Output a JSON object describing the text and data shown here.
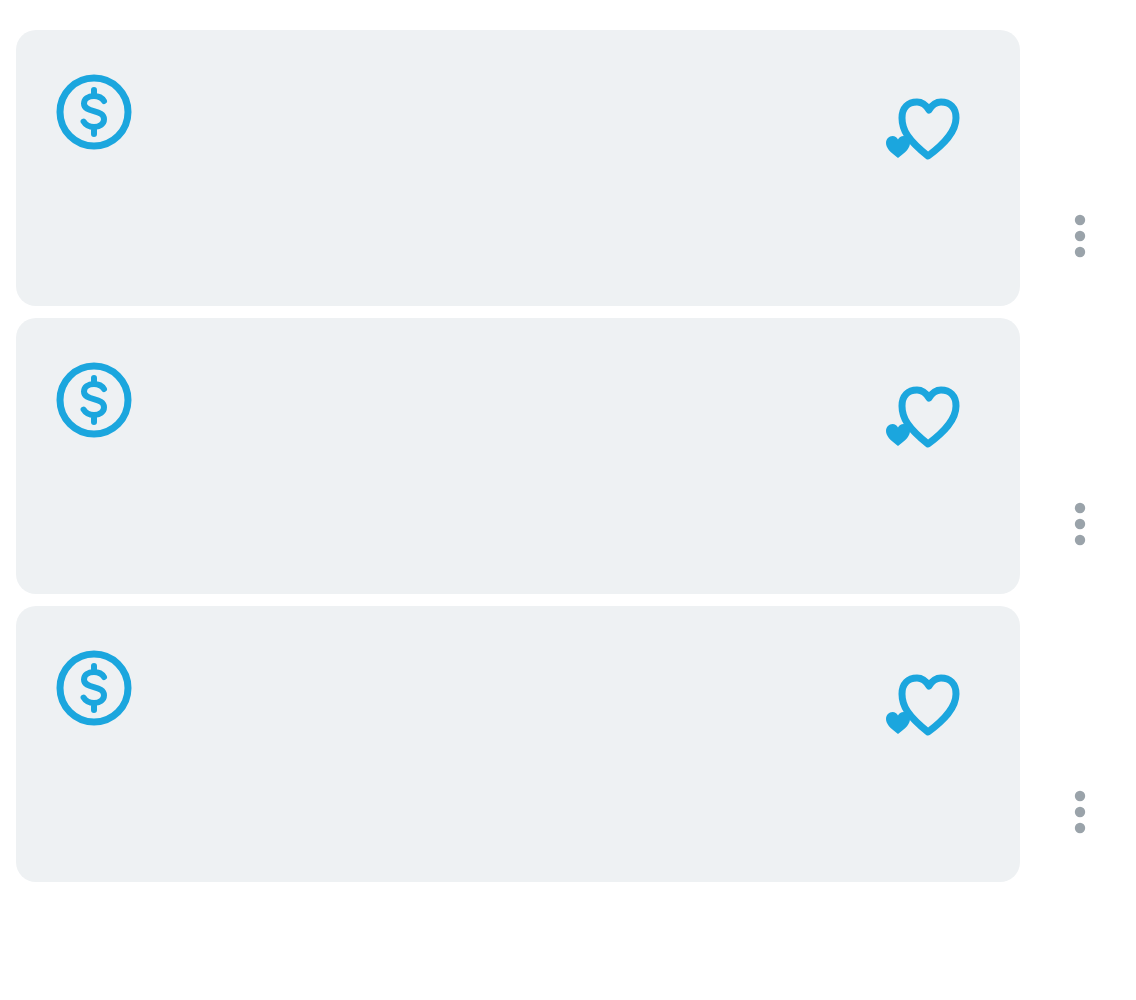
{
  "cards": [
    {
      "kind": "payment"
    },
    {
      "kind": "payment"
    },
    {
      "kind": "payment"
    }
  ]
}
